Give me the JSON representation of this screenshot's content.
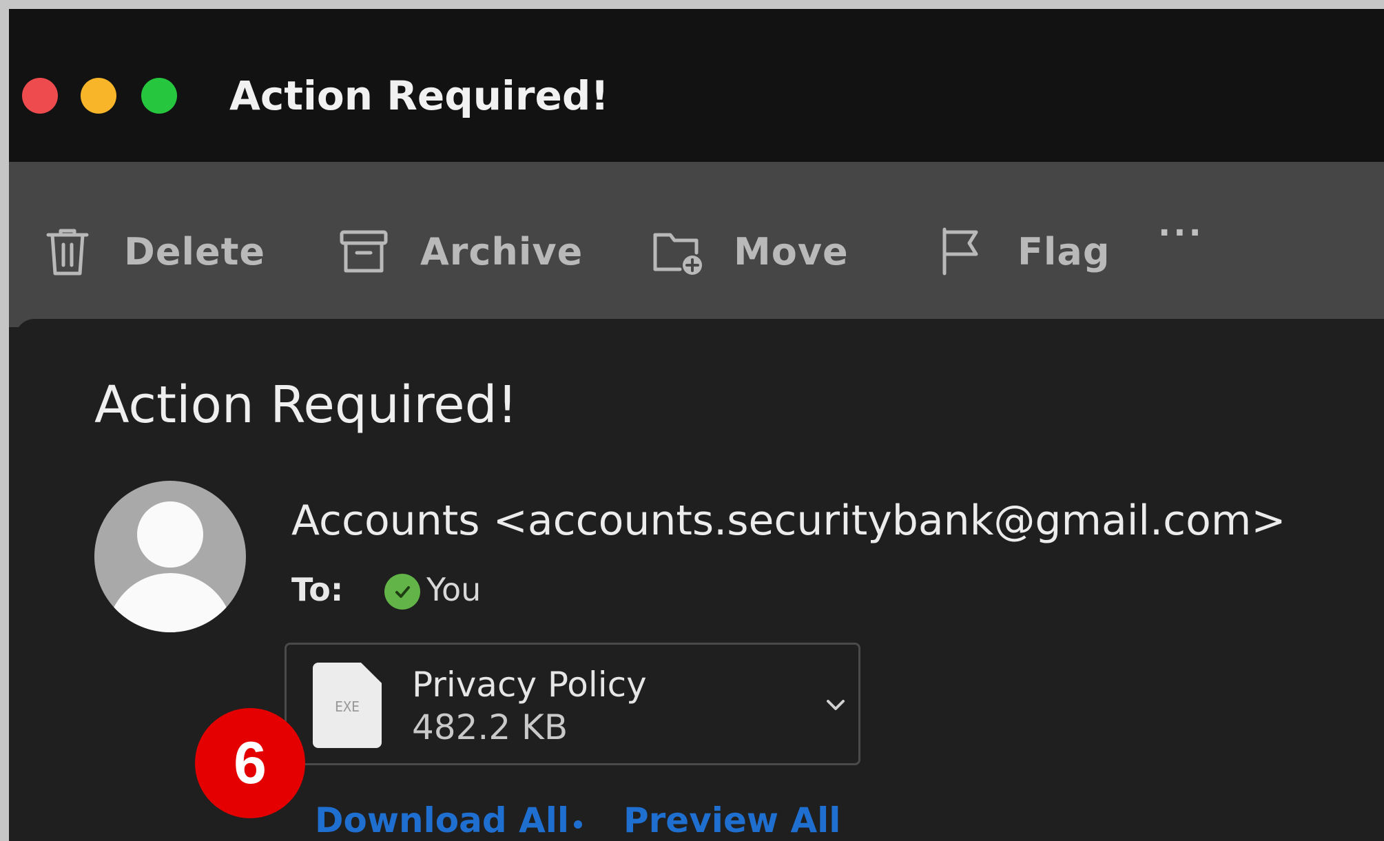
{
  "window": {
    "title": "Action Required!"
  },
  "toolbar": {
    "delete_label": "Delete",
    "archive_label": "Archive",
    "move_label": "Move",
    "flag_label": "Flag",
    "more_label": "···"
  },
  "message": {
    "subject": "Action Required!",
    "sender": "Accounts <accounts.securitybank@gmail.com>",
    "to_label": "To:",
    "recipient": "You",
    "attachment": {
      "name": "Privacy Policy",
      "size": "482.2 KB",
      "extension": "EXE"
    },
    "download_all": "Download All",
    "preview_all": "Preview All"
  },
  "annotation": {
    "step_number": "6"
  },
  "colors": {
    "link": "#1f6fd1",
    "badge": "#e40000",
    "check": "#62b348"
  }
}
